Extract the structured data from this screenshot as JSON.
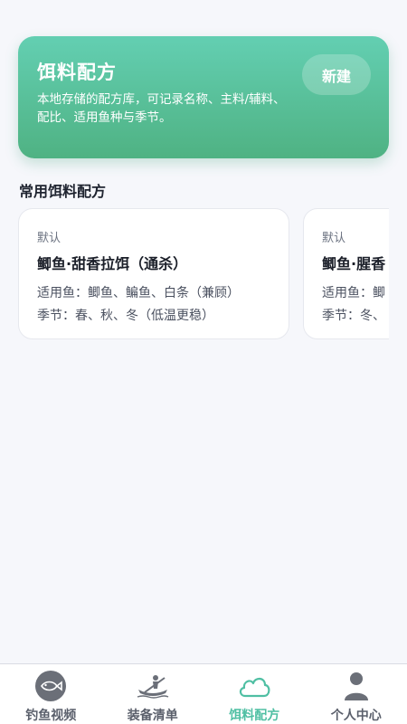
{
  "hero": {
    "title": "饵料配方",
    "description": "本地存储的配方库，可记录名称、主料/辅料、配比、适用鱼种与季节。",
    "new_button": "新建"
  },
  "section": {
    "title": "常用饵料配方"
  },
  "recipes": [
    {
      "tag": "默认",
      "name": "鲫鱼·甜香拉饵（通杀）",
      "fish": "适用鱼：鲫鱼、鳊鱼、白条（兼顾）",
      "season": "季节：春、秋、冬（低温更稳）"
    },
    {
      "tag": "默认",
      "name": "鲫鱼·腥香",
      "fish": "适用鱼：鲫",
      "season": "季节：冬、"
    }
  ],
  "tabbar": {
    "items": [
      {
        "label": "钓鱼视频",
        "icon": "fish-icon",
        "active": false
      },
      {
        "label": "装备清单",
        "icon": "kayak-icon",
        "active": false
      },
      {
        "label": "饵料配方",
        "icon": "cloud-icon",
        "active": true
      },
      {
        "label": "个人中心",
        "icon": "person-icon",
        "active": false
      }
    ]
  },
  "colors": {
    "accent": "#4fbfa3",
    "hero_top": "#63cfb2",
    "hero_bottom": "#4fb283"
  }
}
